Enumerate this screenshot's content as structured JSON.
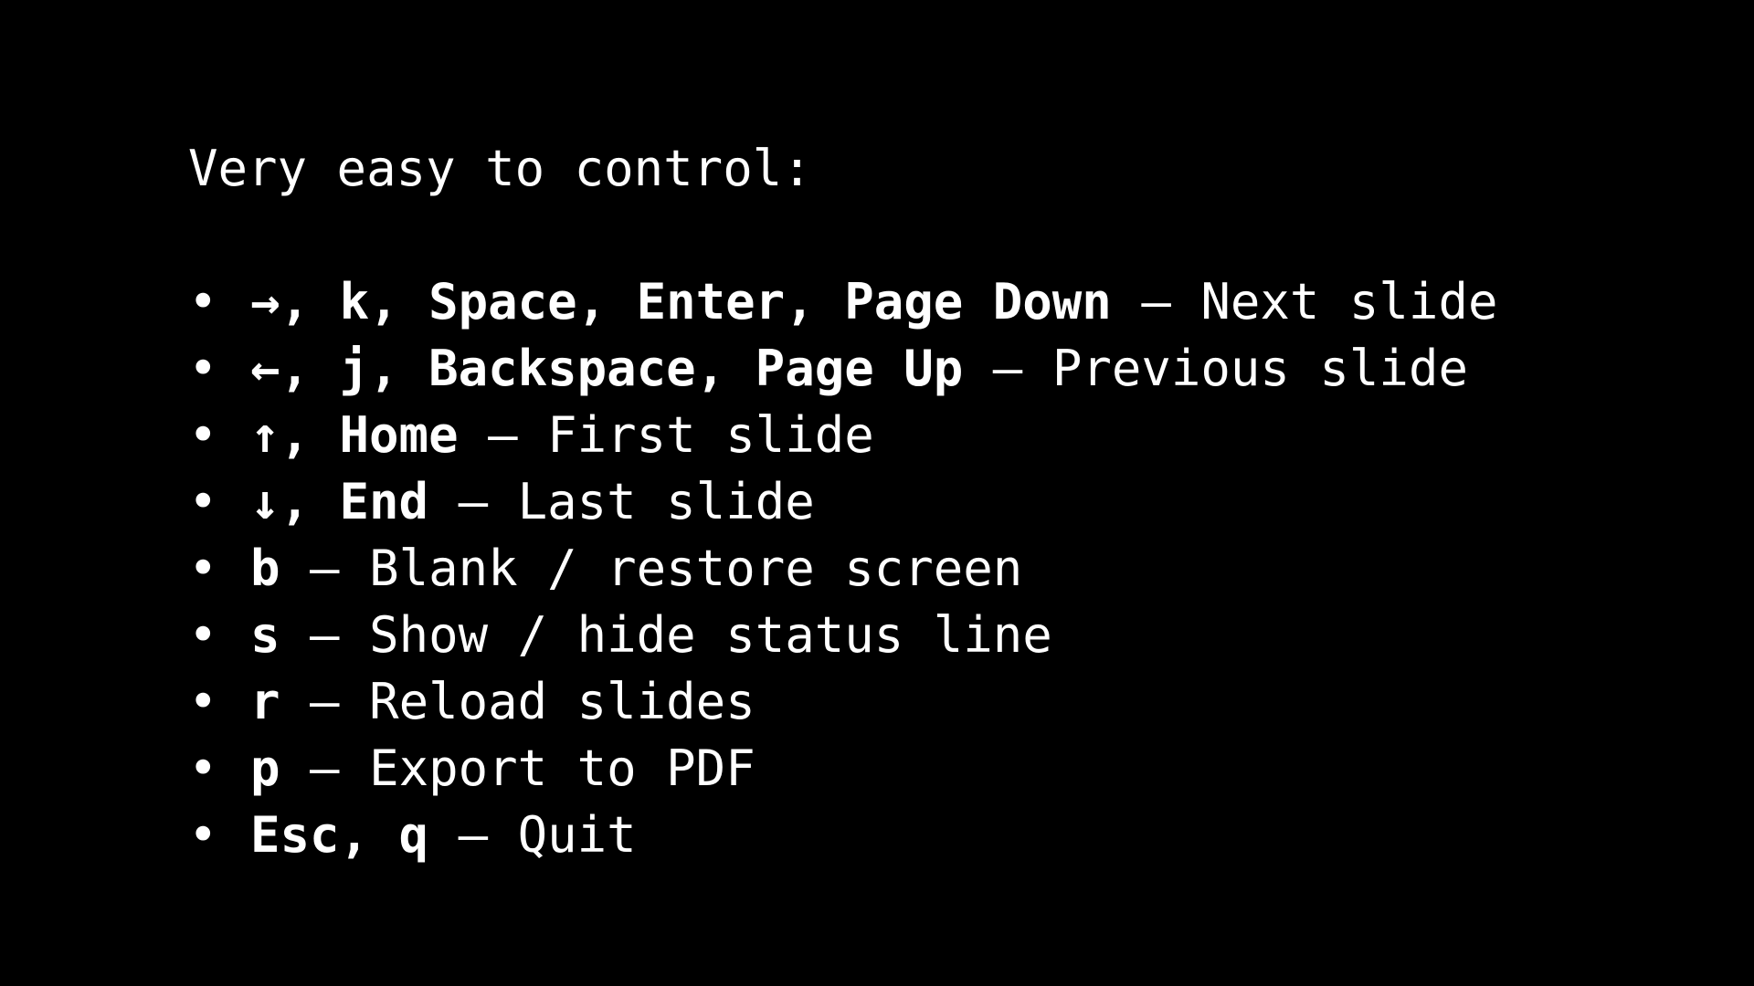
{
  "slide": {
    "intro": "Very easy to control:",
    "bullet_glyph": "•",
    "dash": " – ",
    "items": [
      {
        "keys": "→, k, Space, Enter, Page Down",
        "action": "Next slide"
      },
      {
        "keys": "←, j, Backspace, Page Up",
        "action": "Previous slide"
      },
      {
        "keys": "↑, Home",
        "action": "First slide"
      },
      {
        "keys": "↓, End",
        "action": "Last slide"
      },
      {
        "keys": "b",
        "action": "Blank / restore screen"
      },
      {
        "keys": "s",
        "action": "Show / hide status line"
      },
      {
        "keys": "r",
        "action": "Reload slides"
      },
      {
        "keys": "p",
        "action": "Export to PDF"
      },
      {
        "keys": "Esc, q",
        "action": "Quit"
      }
    ]
  },
  "colors": {
    "background": "#000000",
    "text": "#ffffff"
  }
}
